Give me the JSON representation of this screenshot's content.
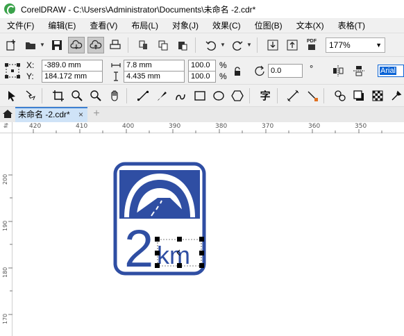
{
  "window": {
    "title": "CorelDRAW - C:\\Users\\Administrator\\Documents\\未命名 -2.cdr*"
  },
  "menu": [
    "文件(F)",
    "编辑(E)",
    "查看(V)",
    "布局(L)",
    "对象(J)",
    "效果(C)",
    "位图(B)",
    "文本(X)",
    "表格(T)"
  ],
  "toolbar": {
    "zoom_value": "177%",
    "pdf_label": "PDF"
  },
  "properties": {
    "x_label": "X:",
    "y_label": "Y:",
    "x_value": "-389.0 mm",
    "y_value": "184.172 mm",
    "width_value": "7.8 mm",
    "height_value": "4.435 mm",
    "scale_x": "100.0",
    "scale_y": "100.0",
    "percent": "%",
    "rotation_value": "0.0",
    "degree": "°",
    "font_name": "Arial"
  },
  "document_tab": {
    "label": "未命名 -2.cdr*",
    "close": "×"
  },
  "rulers": {
    "horizontal": [
      "420",
      "410",
      "400",
      "390",
      "380",
      "370",
      "360",
      "350"
    ],
    "vertical": [
      "200",
      "190",
      "180",
      "170"
    ]
  },
  "sign": {
    "number": "2",
    "unit": "km",
    "color": "#2f4ea3"
  }
}
